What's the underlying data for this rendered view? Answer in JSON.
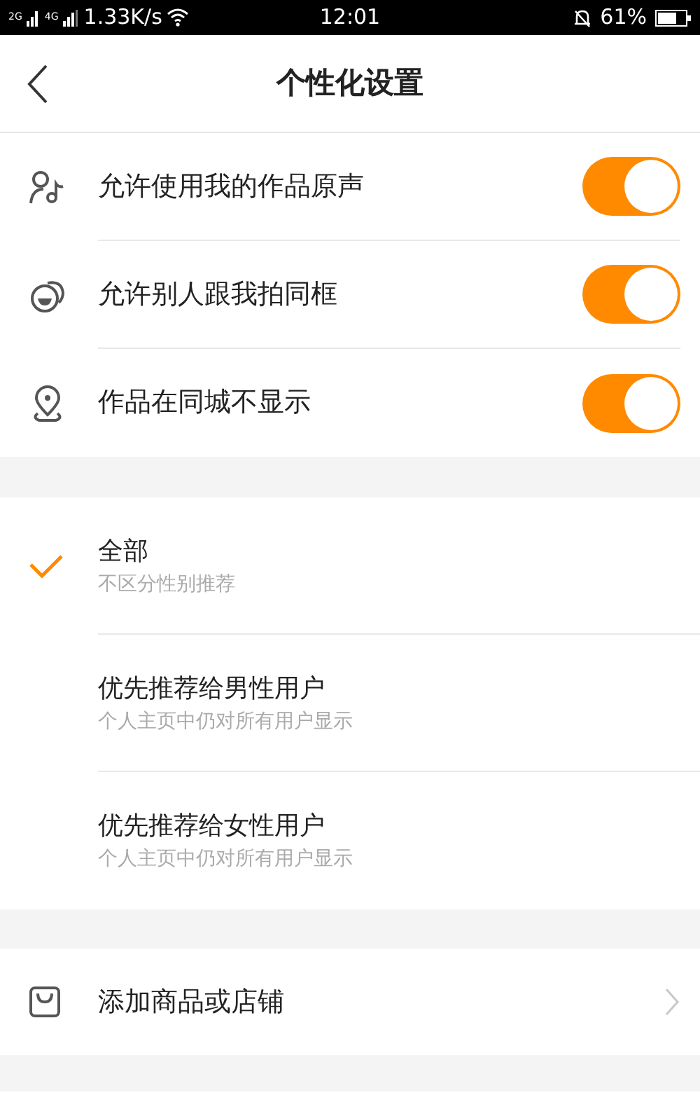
{
  "status_bar": {
    "network_1": "2G",
    "network_2": "4G",
    "speed": "1.33K/s",
    "time": "12:01",
    "battery": "61%"
  },
  "header": {
    "title": "个性化设置"
  },
  "toggles": [
    {
      "label": "允许使用我的作品原声",
      "on": true
    },
    {
      "label": "允许别人跟我拍同框",
      "on": true
    },
    {
      "label": "作品在同城不显示",
      "on": true
    }
  ],
  "recommend_options": [
    {
      "title": "全部",
      "subtitle": "不区分性别推荐",
      "selected": true
    },
    {
      "title": "优先推荐给男性用户",
      "subtitle": "个人主页中仍对所有用户显示",
      "selected": false
    },
    {
      "title": "优先推荐给女性用户",
      "subtitle": "个人主页中仍对所有用户显示",
      "selected": false
    }
  ],
  "links": [
    {
      "label": "添加商品或店铺"
    }
  ]
}
